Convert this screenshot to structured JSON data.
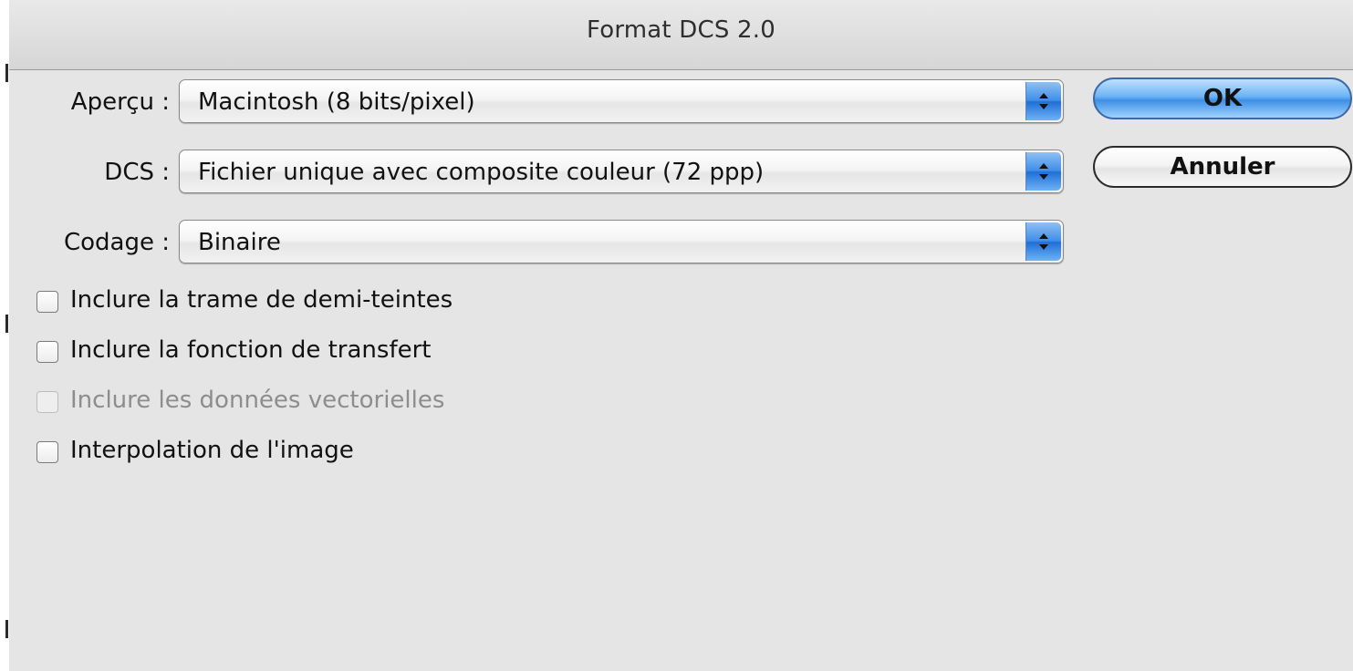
{
  "window": {
    "title": "Format DCS 2.0"
  },
  "fields": {
    "apercu": {
      "label": "Aperçu :",
      "value": "Macintosh (8 bits/pixel)"
    },
    "dcs": {
      "label": "DCS :",
      "value": "Fichier unique avec composite couleur (72 ppp)"
    },
    "codage": {
      "label": "Codage :",
      "value": "Binaire"
    }
  },
  "buttons": {
    "ok": "OK",
    "cancel": "Annuler"
  },
  "options": [
    {
      "label": "Inclure la trame de demi-teintes",
      "checked": false,
      "enabled": true
    },
    {
      "label": "Inclure la fonction de transfert",
      "checked": false,
      "enabled": true
    },
    {
      "label": "Inclure les données vectorielles",
      "checked": false,
      "enabled": false
    },
    {
      "label": "Interpolation de l'image",
      "checked": false,
      "enabled": true
    }
  ],
  "colors": {
    "dialog_bg": "#e5e5e5",
    "accent_blue": "#3e8fe6",
    "disabled_text": "#8d8d8d"
  },
  "icons": {
    "popup_arrows": "up-down-chevrons-icon"
  }
}
